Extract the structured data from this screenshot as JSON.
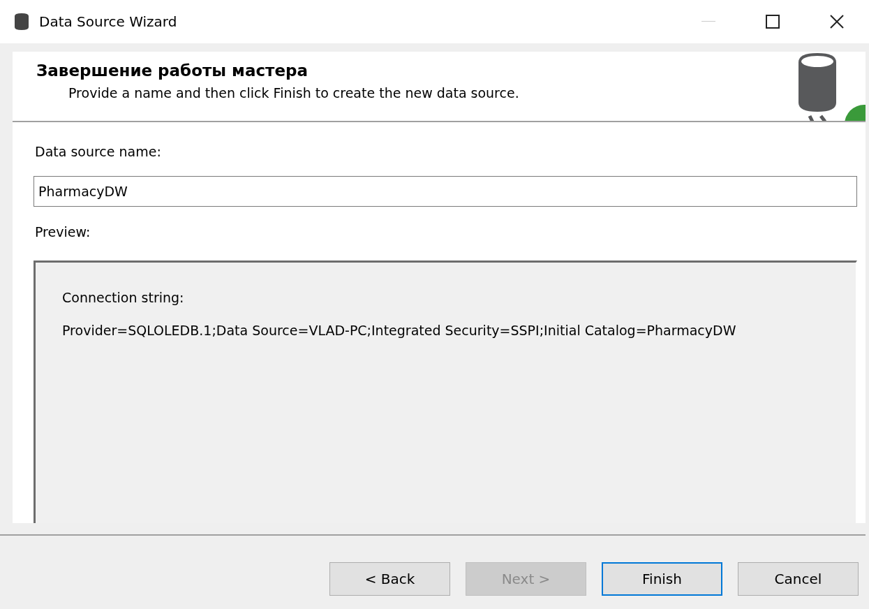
{
  "window": {
    "title": "Data Source Wizard"
  },
  "header": {
    "title": "Завершение работы мастера",
    "subtitle": "Provide a name and then click Finish to create the new data source."
  },
  "name_field": {
    "label": "Data source name:",
    "value": "PharmacyDW"
  },
  "preview": {
    "label": "Preview:",
    "heading": "Connection string:",
    "text": "Provider=SQLOLEDB.1;Data Source=VLAD-PC;Integrated Security=SSPI;Initial Catalog=PharmacyDW"
  },
  "buttons": [
    {
      "label": "< Back",
      "disabled": false,
      "selected": false
    },
    {
      "label": "Next >",
      "disabled": true,
      "selected": false
    },
    {
      "label": "Finish",
      "disabled": false,
      "selected": true
    },
    {
      "label": "Cancel",
      "disabled": false,
      "selected": false
    }
  ]
}
